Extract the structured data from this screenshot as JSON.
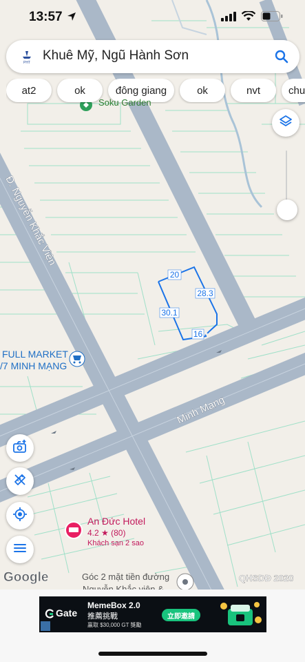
{
  "status": {
    "time": "13:57"
  },
  "search": {
    "text": "Khuê Mỹ, Ngũ Hành Sơn"
  },
  "chips": [
    "at2",
    "ok",
    "đông giang",
    "ok",
    "nvt",
    "chu"
  ],
  "map": {
    "streets": [
      "Đ. Nguyễn Khắc Viện",
      "Minh Mạng"
    ],
    "plot_dimensions": [
      "20",
      "28.3",
      "30.1",
      "16"
    ],
    "pois": {
      "garden": "Soku Garden",
      "market_line1": "FULL MARKET",
      "market_line2": "/7 MINH MẠNG",
      "hotel_name": "An Đức Hotel",
      "hotel_rating": "4.2 ★ (80)",
      "hotel_type": "Khách sạn 2 sao",
      "corner_line1": "Góc 2 mặt tiền đường",
      "corner_line2": "Nguyễn Khắc viện &"
    },
    "google_logo": "Google",
    "attribution": "QHSDĐ 2020"
  },
  "ad": {
    "brand": "Gate",
    "title": "MemeBox 2.0",
    "subtitle": "推薦挑戰",
    "fine": "贏取 $30,000 GT 獎勵",
    "cta": "立即邀請"
  },
  "icons": {
    "status": [
      "location-arrow-icon",
      "signal-icon",
      "wifi-icon",
      "battery-icon"
    ],
    "search": [
      "app-logo-icon",
      "search-icon"
    ],
    "map_controls": [
      "layers-icon",
      "add-photo-icon",
      "measure-icon",
      "my-location-icon",
      "menu-icon"
    ]
  },
  "colors": {
    "map_background": "#f2efe9",
    "road": "#aab8c8",
    "parcel_lines": "#9fe0c8",
    "plot_outline": "#1a73e8",
    "hotel": "#c2185b",
    "market": "#1f6fc5",
    "accent": "#1a73e8"
  }
}
